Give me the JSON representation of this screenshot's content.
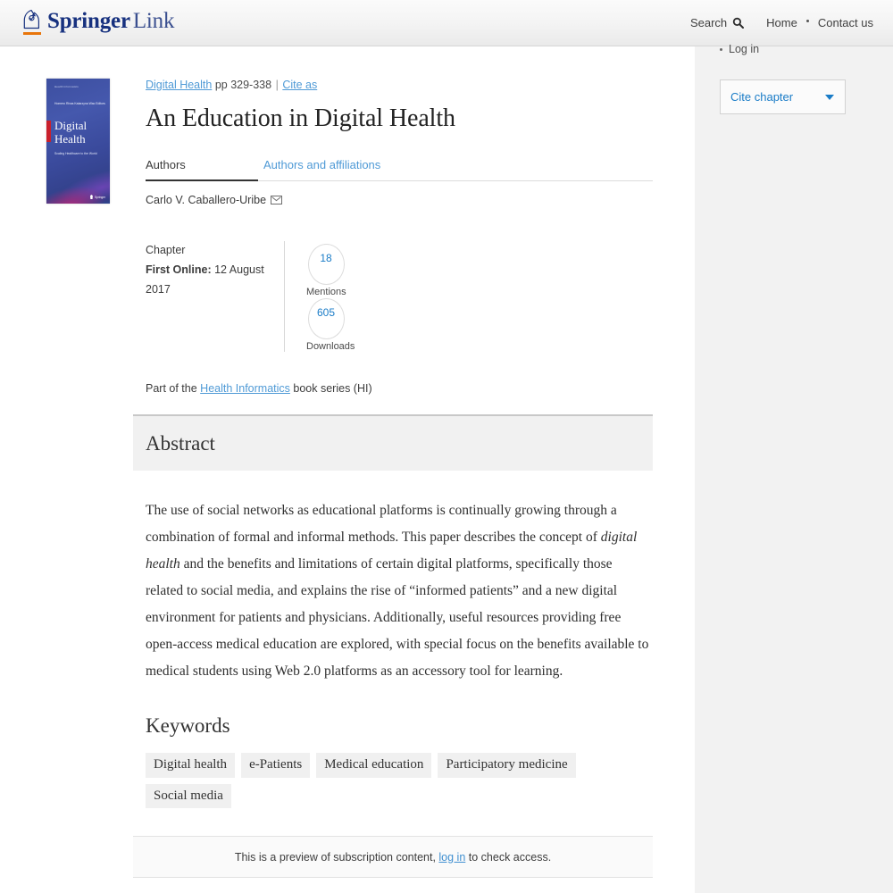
{
  "header": {
    "logo": {
      "bold_word": "Springer",
      "light_word": "Link",
      "mark": "springer-knight-logo"
    },
    "nav": {
      "search_label": "Search",
      "home_label": "Home",
      "contact_label": "Contact us"
    }
  },
  "rail": {
    "login_label": "Log in",
    "cite_button_label": "Cite chapter"
  },
  "cover": {
    "series": "Health Informatics",
    "editors": "Homero Rivas\nKatarzyna Wac  Editors",
    "title_line1": "Digital",
    "title_line2": "Health",
    "subtitle": "Scaling Healthcare to the World",
    "publisher": "Springer"
  },
  "breadcrumb": {
    "book_link": "Digital Health",
    "pages": "pp 329-338",
    "separator": "|",
    "cite_as": "Cite as"
  },
  "chapter": {
    "title": "An Education in Digital Health",
    "type_label": "Chapter",
    "first_online_label": "First Online:",
    "first_online_value": "12 August 2017"
  },
  "tabs": [
    {
      "label": "Authors",
      "active": true
    },
    {
      "label": "Authors and affiliations",
      "active": false
    }
  ],
  "authors": {
    "name": "Carlo V. Caballero-Uribe",
    "contact_icon": "envelope-icon"
  },
  "metrics": [
    {
      "value": "18",
      "caption": "Mentions"
    },
    {
      "value": "605",
      "caption": "Downloads"
    }
  ],
  "series_info": {
    "prefix": "Part of the",
    "link": "Health Informatics",
    "suffix": "book series (HI)"
  },
  "abstract": {
    "heading": "Abstract",
    "part1": "The use of social networks as educational platforms is continually growing through a combination of formal and informal methods. This paper describes the concept of ",
    "italic": "digital health",
    "part2": " and the benefits and limitations of certain digital platforms, specifically those related to social media, and explains the rise of “informed patients” and a new digital environment for patients and physicians. Additionally, useful resources providing free open-access medical education are explored, with special focus on the benefits available to medical students using Web 2.0 platforms as an accessory tool for learning."
  },
  "keywords": {
    "heading": "Keywords",
    "items": [
      "Digital health",
      "e-Patients",
      "Medical education",
      "Participatory medicine",
      "Social media"
    ]
  },
  "preview": {
    "text_before": "This is a preview of subscription content,",
    "link": "log in",
    "text_after": "to check access."
  },
  "colors": {
    "link_blue": "#4f9ad6",
    "accent_blue": "#1a7cc7",
    "brand_navy": "#17317f",
    "brand_orange": "#e8750a"
  }
}
